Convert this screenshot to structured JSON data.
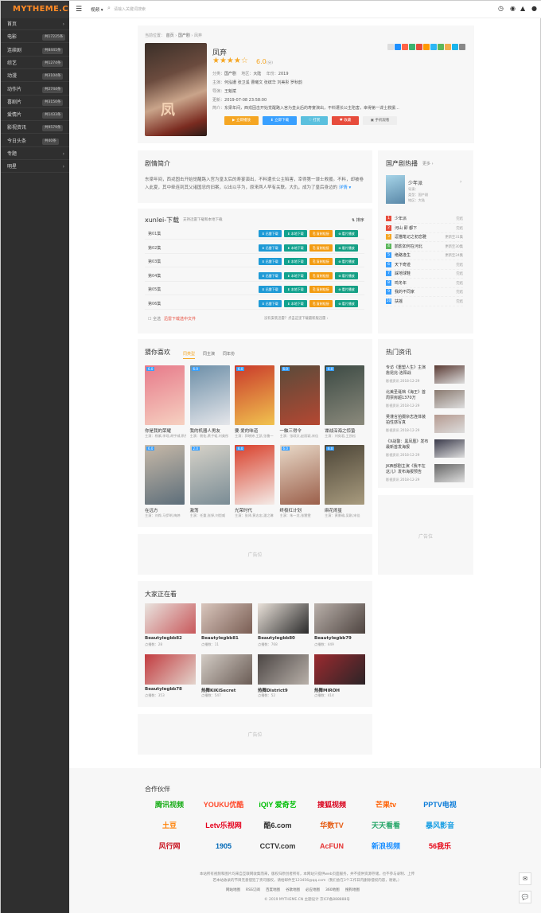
{
  "app": {
    "logo": "MYTHEME.CN"
  },
  "sidebar": {
    "items": [
      {
        "label": "首页",
        "count": "",
        "arrow": "›"
      },
      {
        "label": "电影",
        "count": "共17225条",
        "arrow": ""
      },
      {
        "label": "连续剧",
        "count": "共8441条",
        "arrow": ""
      },
      {
        "label": "综艺",
        "count": "共1274条",
        "arrow": ""
      },
      {
        "label": "动漫",
        "count": "共3104条",
        "arrow": ""
      },
      {
        "label": "动作片",
        "count": "共2744条",
        "arrow": ""
      },
      {
        "label": "喜剧片",
        "count": "共3150条",
        "arrow": ""
      },
      {
        "label": "爱情片",
        "count": "共1433条",
        "arrow": ""
      },
      {
        "label": "影视资讯",
        "count": "共9579条",
        "arrow": ""
      },
      {
        "label": "今日头条",
        "count": "共40条",
        "arrow": ""
      },
      {
        "label": "专题",
        "count": "",
        "arrow": "›"
      },
      {
        "label": "明星",
        "count": "",
        "arrow": "›"
      }
    ]
  },
  "topbar": {
    "dropdown": "视频 ▾",
    "search_placeholder": "请输入关键词搜索",
    "icons": [
      "history-icon",
      "rss-icon",
      "android-icon",
      "user-icon"
    ]
  },
  "detail": {
    "breadcrumb": {
      "prefix": "当前位置：",
      "home": "首页",
      "sep1": "›",
      "cat": "国产剧",
      "sep2": "›",
      "title": "凤弃"
    },
    "poster_text": "凤",
    "title": "凤弃",
    "stars": "★★★★☆",
    "score": "6.0",
    "score_unit": "(分)",
    "type_label": "分类：",
    "type": "国产剧",
    "region_label": "地区：",
    "region": "大陆",
    "year_label": "年份：",
    "year": "2019",
    "cast_label": "主演：",
    "cast": "何泓姗 张卫溪 曹曦文 张缤华 刘美彤 罗秋韵",
    "director_label": "导演：",
    "director": "王魁斌",
    "update_label": "更新：",
    "update": "2019-07-08 23:58:00",
    "intro_label": "简介：",
    "intro_short": "东梁年间，西戎固击开始觉醒路入宫为皇太后的寿宴演出，不料遭长公主陷害，幸得第一谍士救援...",
    "buttons": [
      {
        "label": "▶ 立即播放",
        "color": "#f5a623"
      },
      {
        "label": "⬇ 立即下载",
        "color": "#39a0ff"
      },
      {
        "label": "♡ 打赏",
        "color": "#5bc0de"
      },
      {
        "label": "♥ 收藏",
        "color": "#e74c3c"
      },
      {
        "label": "▣ 手机观看",
        "color": "#eee"
      }
    ],
    "share_colors": [
      "#ddd",
      "#1e90ff",
      "#ff6347",
      "#3cb371",
      "#e74c3c",
      "#ff9900",
      "#2db7f5",
      "#5cb85c",
      "#f0ad4e",
      "#1ab5ec",
      "#888"
    ]
  },
  "plot": {
    "title": "剧情简介",
    "text": "东梁年间，西戎固击开始觉醒路入宫为皇太后的寿宴演出，不料遭长公主陷害，幸得第一谍士救援。不料，却被卷入此夏，其中牵连到其父诸国忠的旧案，以出以乎为，原来两人早有关联。大仇，成为了皇后身边的",
    "more": "详情 ▾"
  },
  "download": {
    "title": "xunlei-下载",
    "subtitle": "支持迅雷下载和本地下载",
    "sort": "⇅ 排序",
    "episodes": [
      "第01集",
      "第02集",
      "第03集",
      "第04集",
      "第05集",
      "第06集"
    ],
    "btn_labels": [
      "⬇ 迅雷下载",
      "⬇ 本地下载",
      "⎘ 复制链接",
      "⊕ 看片播放"
    ],
    "select_all": "☐ 全选",
    "batch": "迅雷下载选中文件",
    "tip": "没有安装迅雷？点击这里下载最新版迅雷 ›"
  },
  "guess": {
    "title": "猜你喜欢",
    "tabs": [
      "同类型",
      "同主演",
      "同年份"
    ],
    "movies": [
      {
        "name": "你是我的荣耀",
        "cast": "主演：杨紫,李现,胡宇威,靳东",
        "badge": "6.0",
        "colors": [
          "#e77a8a",
          "#f6d1c1"
        ]
      },
      {
        "name": "我的机器人男友",
        "cast": "主演：裴佑,黄子韬,刘美彤",
        "badge": "6.0",
        "colors": [
          "#6d8fa8",
          "#e5e6ea"
        ]
      },
      {
        "name": "要·爱的味道",
        "cast": "主演：郭晓婷,王凯,张鲁一",
        "badge": "6.0",
        "colors": [
          "#c93a2b",
          "#f1c34f"
        ]
      },
      {
        "name": "一触三得令",
        "cast": "主演：张颂文,赵丽颖,宋佳",
        "badge": "6.0",
        "colors": [
          "#5a4a3a",
          "#b54832"
        ]
      },
      {
        "name": "谍战深海之惊蛰",
        "cast": "主演：刘奕君,王劲松",
        "badge": "6.0",
        "colors": [
          "#3c4a44",
          "#8b8a7c"
        ]
      },
      {
        "name": "在远方",
        "cast": "主演：刘烨,马伊琍,梅婷",
        "badge": "6.0",
        "colors": [
          "#c7b9a8",
          "#5d6e7a"
        ]
      },
      {
        "name": "激荡",
        "cast": "主演：任重,张铎,刘恺威",
        "badge": "2.0",
        "colors": [
          "#d6d2c8",
          "#7a8c95"
        ]
      },
      {
        "name": "光荣时代",
        "cast": "主演：张译,黄志忠,潘之琳",
        "badge": "6.0",
        "colors": [
          "#d9402b",
          "#f4ebe7"
        ]
      },
      {
        "name": "终极杠计划",
        "cast": "主演：朱一龙,张慧雯",
        "badge": "6.0",
        "colors": [
          "#e8d9c8",
          "#9b5f4a"
        ]
      },
      {
        "name": "麻花闹星",
        "cast": "主演：黄景瑜,吴刚,宋佳",
        "badge": "6.0",
        "colors": [
          "#4d4638",
          "#a89b7e"
        ]
      }
    ]
  },
  "hot": {
    "title": "国产剧热播",
    "more": "更多 ›",
    "top": {
      "name": "少年派",
      "meta1": "导演：",
      "meta2": "类型：国产剧",
      "meta3": "地区：大陆"
    },
    "items": [
      {
        "name": "少年派",
        "status": "完结",
        "color": "#e74c3c"
      },
      {
        "name": "河山 即 都下",
        "status": "完结",
        "color": "#e74c3c"
      },
      {
        "name": "逗猫笔记之初恋雅",
        "status": "更新至31集",
        "color": "#f5a623"
      },
      {
        "name": "鹊影如何在河北",
        "status": "更新至30集",
        "color": "#5cb85c"
      },
      {
        "name": "绝路逢生",
        "status": "更新至24集",
        "color": "#39a0ff"
      },
      {
        "name": "天下奇迹",
        "status": "完结",
        "color": "#39a0ff"
      },
      {
        "name": "踩地球鞋",
        "status": "完结",
        "color": "#39a0ff"
      },
      {
        "name": "鸣冬年",
        "status": "完结",
        "color": "#39a0ff"
      },
      {
        "name": "我的不同家",
        "status": "完结",
        "color": "#39a0ff"
      },
      {
        "name": "扶摇",
        "status": "完结",
        "color": "#39a0ff"
      }
    ]
  },
  "news": {
    "title": "热门资讯",
    "items": [
      {
        "title": "专访《重塑人生》主演詹昆兆·洛阳战",
        "cat": "影视资讯",
        "date": "2018-12-29",
        "color": "#5a3a33"
      },
      {
        "title": "北美圣诞档《海王》首周票房超1370万",
        "cat": "影视资讯",
        "date": "2018-12-29",
        "color": "#8a7a70"
      },
      {
        "title": "吴谨言拍摄杂志连体装拍性感写真",
        "cat": "影视资讯",
        "date": "2018-12-29",
        "color": "#b59a90"
      },
      {
        "title": "《X战警：黑凤凰》发布最新首发海报",
        "cat": "影视资讯",
        "date": "2018-12-29",
        "color": "#3a3a4a"
      },
      {
        "title": "JK西部剧主演《我不在这儿》发布海报预告",
        "cat": "影视资讯",
        "date": "2018-12-29",
        "color": "#666"
      }
    ]
  },
  "ads": {
    "label": "广告位"
  },
  "watching": {
    "title": "大家正在看",
    "items": [
      {
        "name": "Beautylegbb82",
        "count": "点播数：28",
        "colors": [
          "#e9e4df",
          "#c8585b"
        ]
      },
      {
        "name": "Beautylegbb81",
        "count": "点播数：11",
        "colors": [
          "#d9c6bd",
          "#7a5e54"
        ]
      },
      {
        "name": "Beautylegbb80",
        "count": "点播数：768",
        "colors": [
          "#e9e1d9",
          "#2b2b2b"
        ]
      },
      {
        "name": "Beautylegbb79",
        "count": "点播数：449",
        "colors": [
          "#b9b0aa",
          "#4e4440"
        ]
      },
      {
        "name": "Beautylegbb78",
        "count": "点播数：353",
        "colors": [
          "#c23b3f",
          "#e3d4cc"
        ]
      },
      {
        "name": "热舞KiKiSecret",
        "count": "点播数：547",
        "colors": [
          "#d3ccc5",
          "#6a5c55"
        ]
      },
      {
        "name": "热舞District9",
        "count": "点播数：52",
        "colors": [
          "#4c4644",
          "#b8b0a9"
        ]
      },
      {
        "name": "热舞MIROH",
        "count": "点播数：414",
        "colors": [
          "#9b2a2f",
          "#2b2427"
        ]
      }
    ]
  },
  "partners": {
    "title": "合作伙伴",
    "logos": [
      {
        "t": "腾讯视频",
        "c": "#1aad19"
      },
      {
        "t": "YOUKU优酷",
        "c": "#ff4a2b"
      },
      {
        "t": "iQIY 爱奇艺",
        "c": "#00be06"
      },
      {
        "t": "搜狐视频",
        "c": "#d9001b"
      },
      {
        "t": "芒果tv",
        "c": "#ff5f00"
      },
      {
        "t": "PPTV电视",
        "c": "#0a7bd8"
      },
      {
        "t": "土豆",
        "c": "#ff7e00"
      },
      {
        "t": "Letv乐视网",
        "c": "#e5001c"
      },
      {
        "t": "酷6.com",
        "c": "#333"
      },
      {
        "t": "华数TV",
        "c": "#e55b12"
      },
      {
        "t": "天天看看",
        "c": "#29a76b"
      },
      {
        "t": "暴风影音",
        "c": "#1a9fe4"
      },
      {
        "t": "风行网",
        "c": "#c91622"
      },
      {
        "t": "1905",
        "c": "#0068b7"
      },
      {
        "t": "CCTV.com",
        "c": "#333"
      },
      {
        "t": "AcFUN",
        "c": "#e53434"
      },
      {
        "t": "新浪视频",
        "c": "#1e90ff"
      },
      {
        "t": "56我乐",
        "c": "#e60012"
      }
    ]
  },
  "footer": {
    "line1": "本站所有视频和图片均来自互联网收集而来，版权归原创者所有，本网站只提供web页面服务，并不提供资源存储，也不参与录制、上传",
    "line2": "若本站收录的节目无意侵犯了贵司版权，请给邮件至123456@qq.com（我们会在3个工作日内删除侵权内容，谢谢。）",
    "links": [
      "网站地图",
      "RSS订阅",
      "百度地图",
      "谷歌地图",
      "必应地图",
      "360地图",
      "搜狗地图"
    ],
    "copyright": "© 2019 MYTHEME.CN 主题设计 京ICP备888888号"
  }
}
